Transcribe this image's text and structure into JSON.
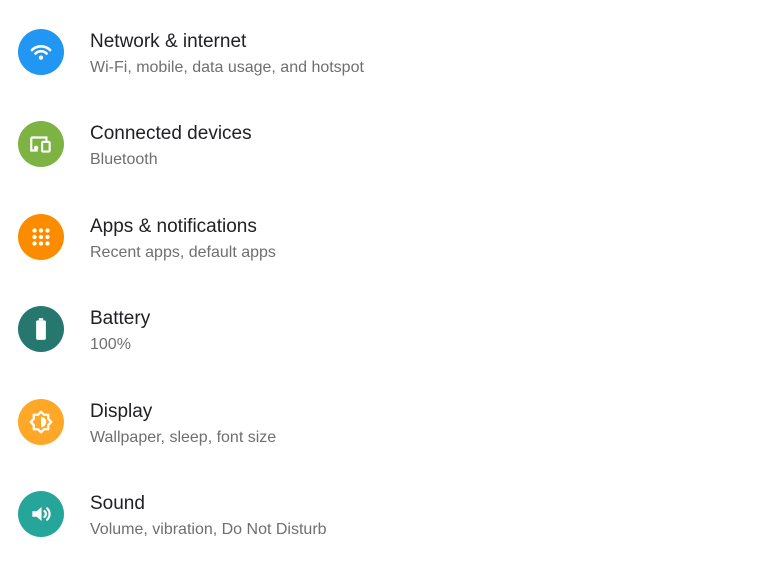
{
  "settings": {
    "items": [
      {
        "title": "Network & internet",
        "summary": "Wi-Fi, mobile, data usage, and hotspot",
        "icon": "wifi-icon",
        "color": "#2196F3"
      },
      {
        "title": "Connected devices",
        "summary": "Bluetooth",
        "icon": "connected-devices-icon",
        "color": "#7CB342"
      },
      {
        "title": "Apps & notifications",
        "summary": "Recent apps, default apps",
        "icon": "apps-grid-icon",
        "color": "#FB8C00"
      },
      {
        "title": "Battery",
        "summary": "100%",
        "icon": "battery-icon",
        "color": "#26786E"
      },
      {
        "title": "Display",
        "summary": "Wallpaper, sleep, font size",
        "icon": "brightness-icon",
        "color": "#FFA726"
      },
      {
        "title": "Sound",
        "summary": "Volume, vibration, Do Not Disturb",
        "icon": "volume-icon",
        "color": "#26A69A"
      }
    ]
  }
}
